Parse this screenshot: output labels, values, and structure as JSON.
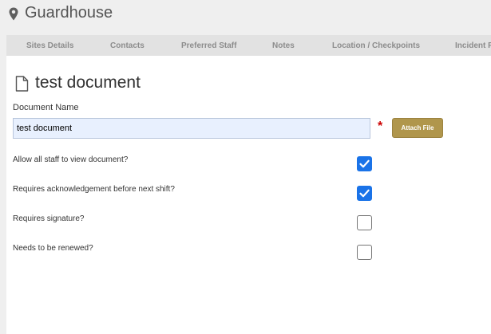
{
  "site": {
    "title": "Guardhouse",
    "icon": "map-pin-icon"
  },
  "tabs": [
    {
      "label": "Sites Details"
    },
    {
      "label": "Contacts"
    },
    {
      "label": "Preferred Staff"
    },
    {
      "label": "Notes"
    },
    {
      "label": "Location / Checkpoints"
    },
    {
      "label": "Incident R"
    }
  ],
  "document": {
    "icon": "document-icon",
    "title": "test document",
    "name_label": "Document Name",
    "name_value": "test document",
    "required_mark": "*",
    "attach_label": "Attach File"
  },
  "options": [
    {
      "label": "Allow all staff to view document?",
      "checked": true
    },
    {
      "label": "Requires acknowledgement before next shift?",
      "checked": true
    },
    {
      "label": "Requires signature?",
      "checked": false
    },
    {
      "label": "Needs to be renewed?",
      "checked": false
    }
  ],
  "colors": {
    "accent_button": "#b0964c",
    "checkbox_on": "#1a73e8",
    "required": "#cc0000"
  }
}
